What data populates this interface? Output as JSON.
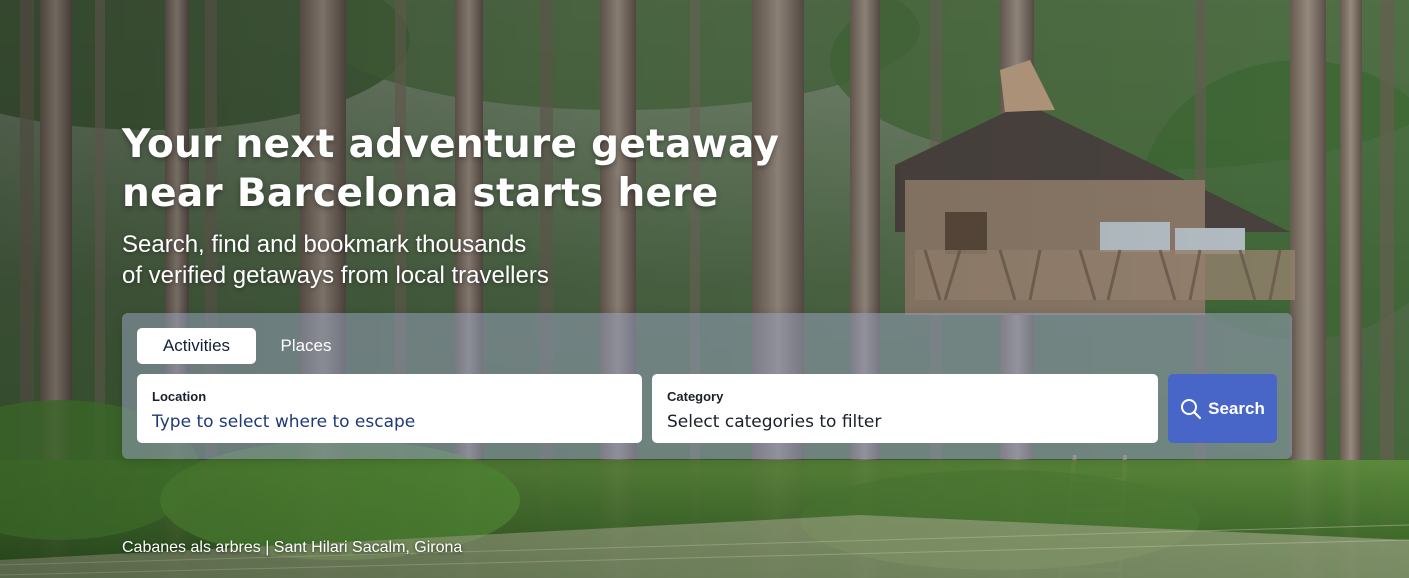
{
  "hero": {
    "headline_line1": "Your next adventure getaway",
    "headline_line2": "near Barcelona starts here",
    "subline_line1": "Search, find and bookmark thousands",
    "subline_line2": "of verified getaways from local travellers",
    "background": "forest-treehouse-photo"
  },
  "search": {
    "tabs": [
      {
        "label": "Activities",
        "active": true
      },
      {
        "label": "Places",
        "active": false
      }
    ],
    "location": {
      "label": "Location",
      "placeholder": "Type to select where to escape"
    },
    "category": {
      "label": "Category",
      "placeholder": "Select categories to filter"
    },
    "button_label": "Search",
    "button_icon": "search-icon"
  },
  "caption": "Cabanes als arbres | Sant Hilari Sacalm, Girona",
  "colors": {
    "primary_button": "#4766c8",
    "panel": "rgba(150,160,185,0.55)",
    "tab_active_bg": "#ffffff",
    "text_dark": "#12203a"
  }
}
